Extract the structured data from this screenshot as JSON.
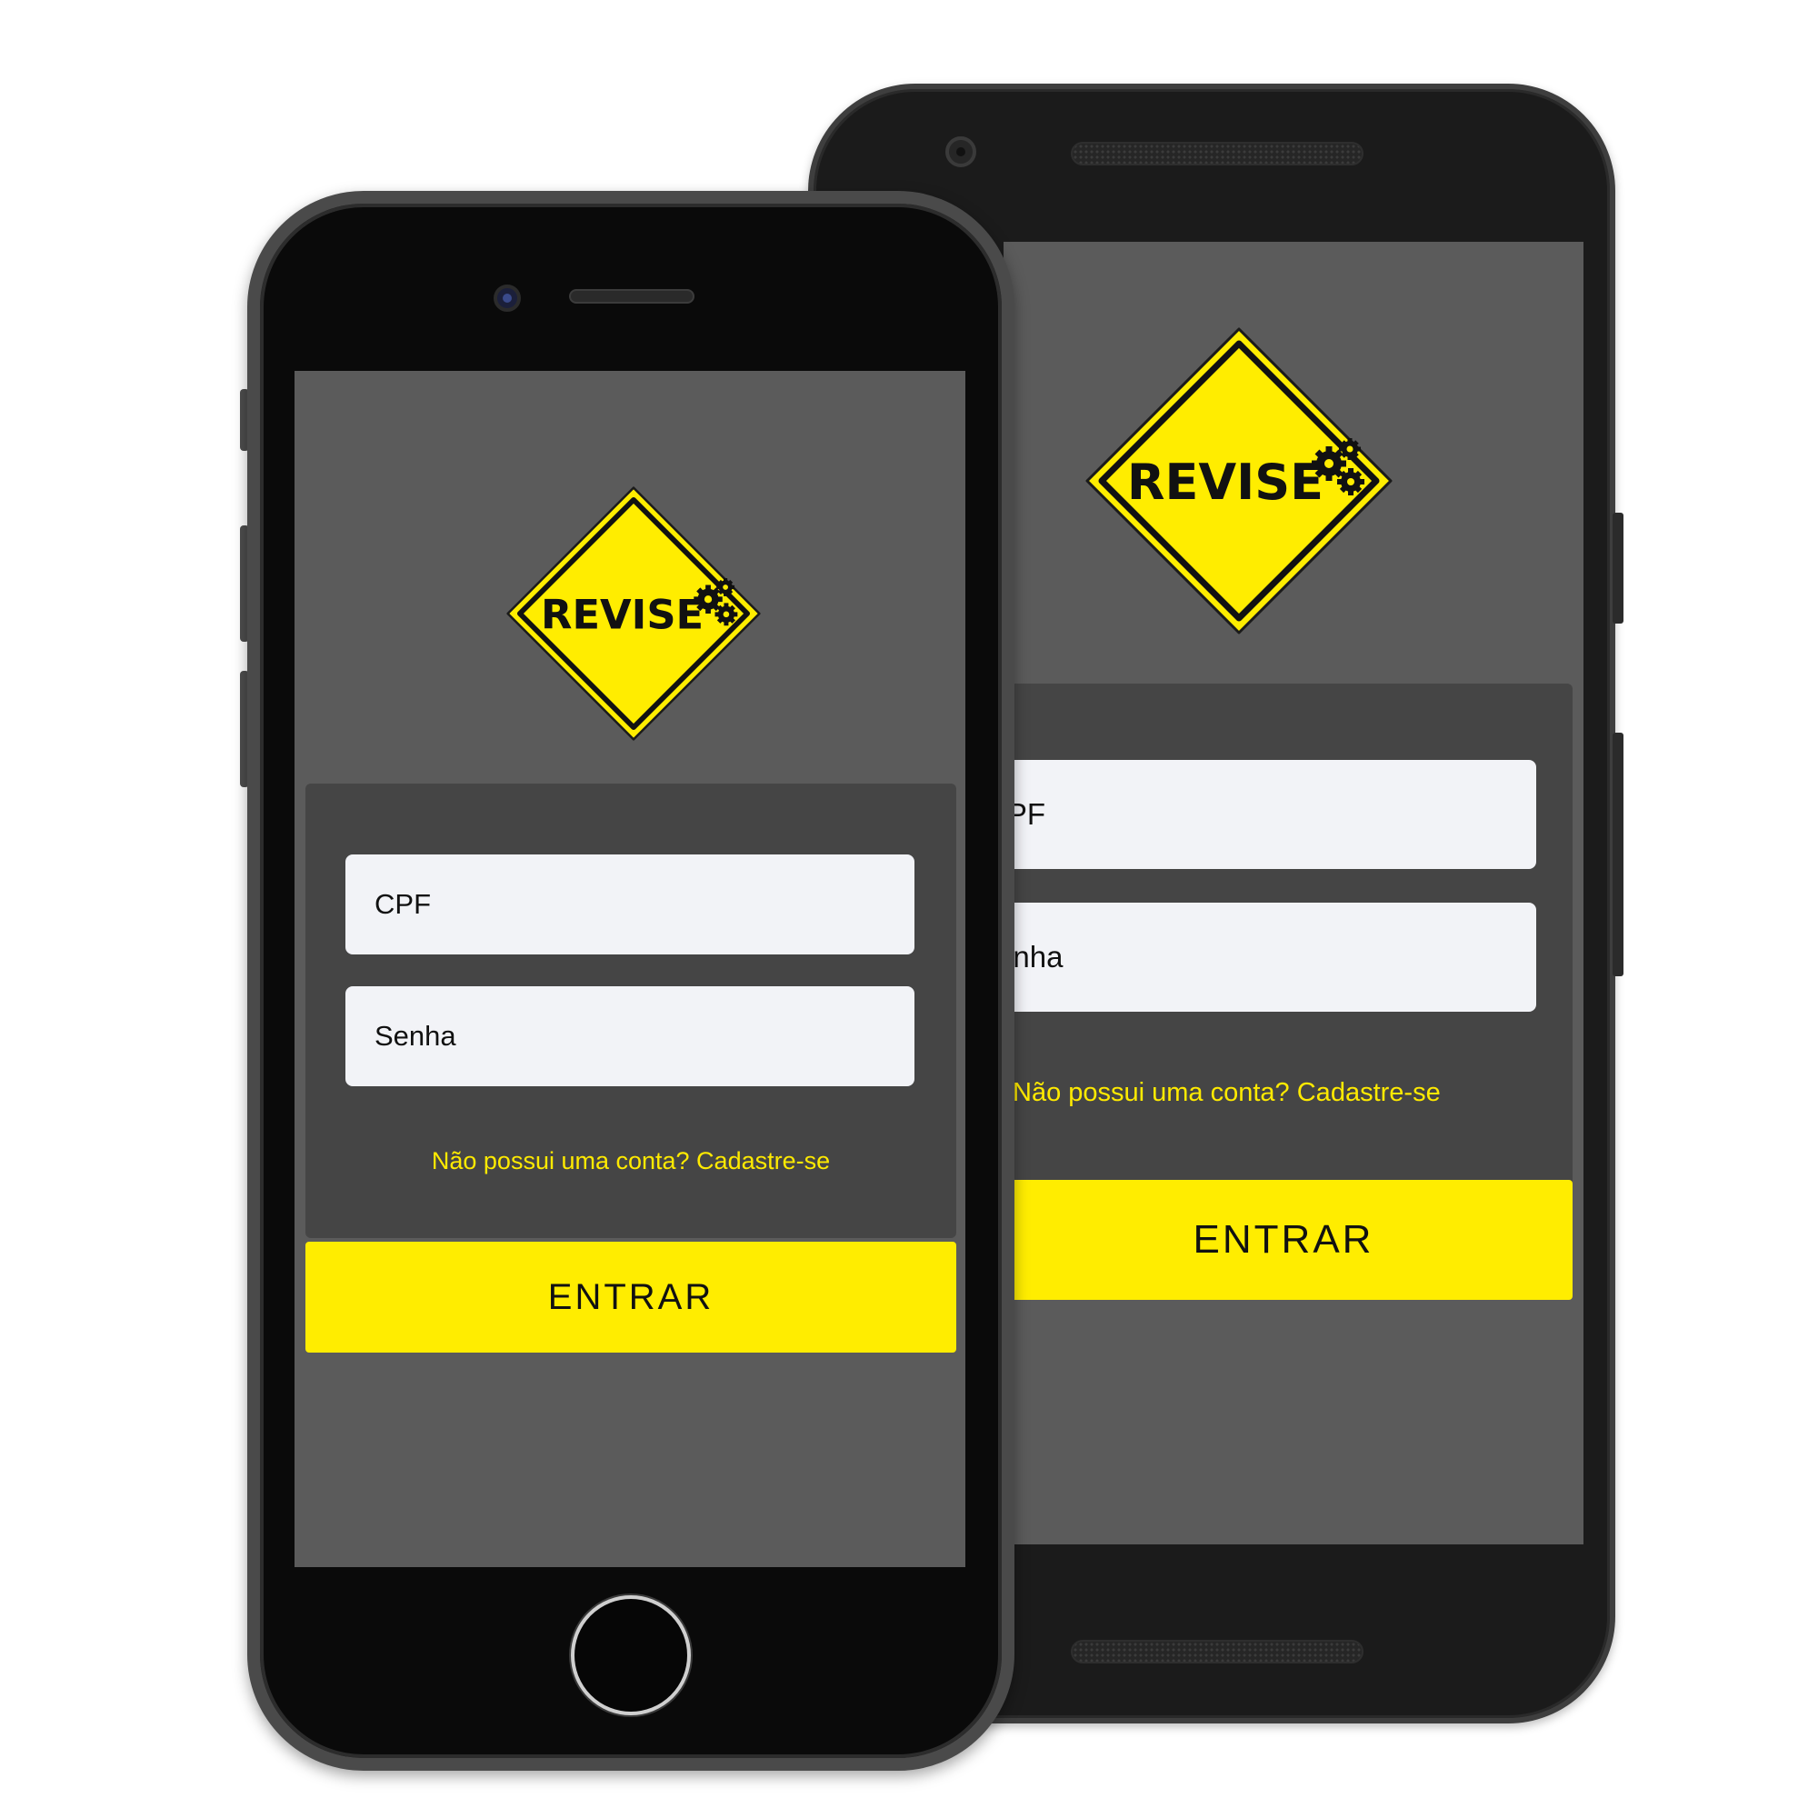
{
  "app": {
    "logo_text": "REVISE",
    "brand_color": "#ffed00",
    "background_color": "#5b5b5b",
    "panel_color": "#454545",
    "field_color": "#f2f3f7"
  },
  "iphone": {
    "cpf_placeholder": "CPF",
    "password_placeholder": "Senha",
    "signup_link": "Não possui uma conta? Cadastre-se",
    "enter_button": "ENTRAR"
  },
  "android": {
    "cpf_placeholder": "CPF",
    "password_placeholder": "Senha",
    "signup_link": "Não possui uma conta? Cadastre-se",
    "enter_button": "ENTRAR"
  },
  "icons": [
    "gears-icon",
    "camera-icon",
    "speaker-grille-icon",
    "home-button-icon"
  ]
}
